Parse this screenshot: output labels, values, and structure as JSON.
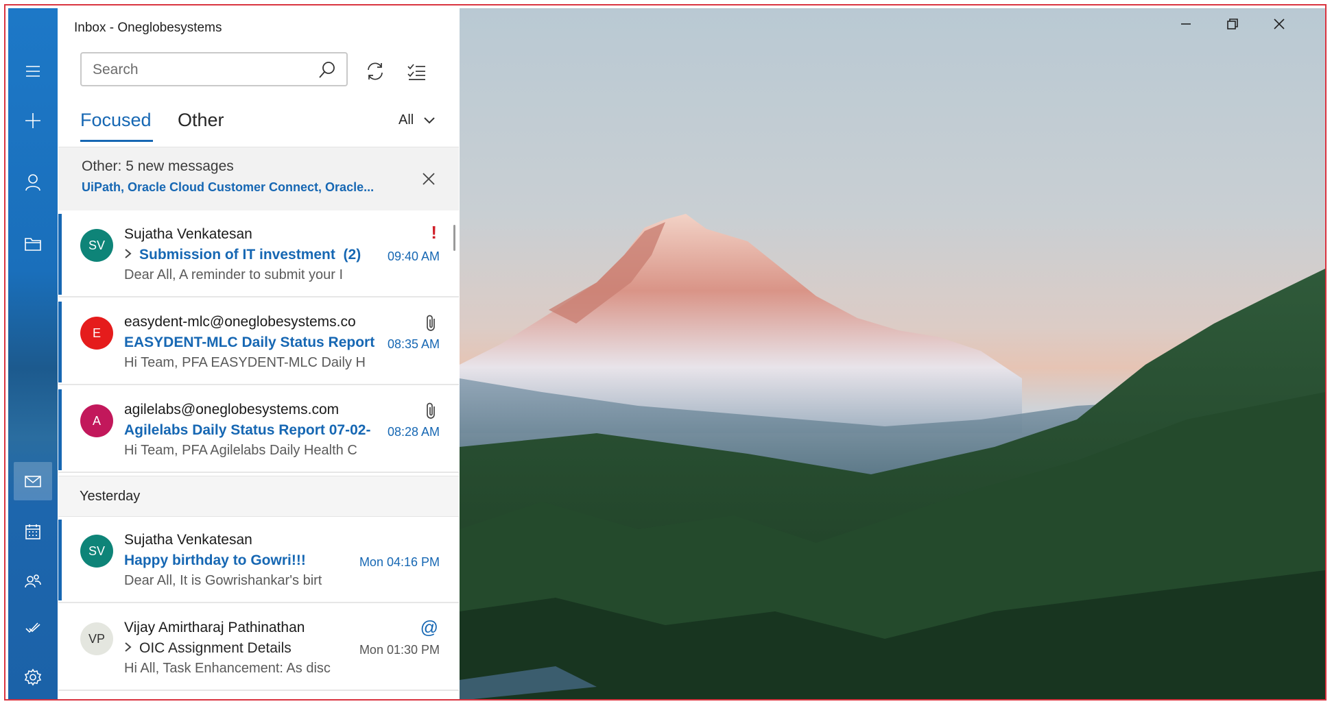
{
  "window": {
    "title": "Inbox - Oneglobesystems"
  },
  "rail": {
    "items": [
      {
        "name": "menu-icon"
      },
      {
        "name": "compose-icon"
      },
      {
        "name": "account-icon"
      },
      {
        "name": "folder-icon"
      },
      {
        "name": "mail-icon",
        "active": true
      },
      {
        "name": "calendar-icon"
      },
      {
        "name": "people-icon"
      },
      {
        "name": "todo-icon"
      },
      {
        "name": "settings-icon"
      }
    ]
  },
  "search": {
    "placeholder": "Search",
    "value": ""
  },
  "tabs": {
    "focused": "Focused",
    "other": "Other",
    "filter": "All"
  },
  "other_banner": {
    "title": "Other: 5 new messages",
    "senders": "UiPath, Oracle Cloud Customer Connect, Oracle..."
  },
  "messages": [
    {
      "sender": "Sujatha Venkatesan",
      "initials": "SV",
      "avatar_color": "#0e8478",
      "subject": "Submission of IT investment",
      "thread_count": "(2)",
      "preview": "Dear All, A reminder to submit your I",
      "time": "09:40 AM",
      "indicator": "!"
    },
    {
      "sender": "easydent-mlc@oneglobesystems.co",
      "initials": "E",
      "avatar_color": "#e51c1c",
      "subject": "EASYDENT-MLC Daily Status Report",
      "preview": "Hi Team, PFA EASYDENT-MLC Daily H",
      "time": "08:35 AM"
    },
    {
      "sender": "agilelabs@oneglobesystems.com",
      "initials": "A",
      "avatar_color": "#c2185b",
      "subject": "Agilelabs Daily Status Report 07-02-",
      "preview": "Hi Team, PFA Agilelabs Daily Health C",
      "time": "08:28 AM"
    }
  ],
  "yesterday_header": "Yesterday",
  "yesterday_messages": [
    {
      "sender": "Sujatha Venkatesan",
      "initials": "SV",
      "avatar_color": "#0e8478",
      "subject": "Happy birthday to Gowri!!!",
      "preview": "Dear All, It is Gowrishankar's birt",
      "time": "Mon 04:16 PM"
    },
    {
      "sender": "Vijay Amirtharaj Pathinathan",
      "initials": "VP",
      "avatar_color": "#e4e6df",
      "subject": "OIC Assignment Details",
      "preview": "Hi All, Task Enhancement: As disc",
      "time": "Mon 01:30 PM",
      "indicator": "@"
    }
  ],
  "colors": {
    "accent": "#1667b3",
    "rail": "#1a6fbb",
    "flag": "#d0202a",
    "frame_border": "#d9333f"
  }
}
